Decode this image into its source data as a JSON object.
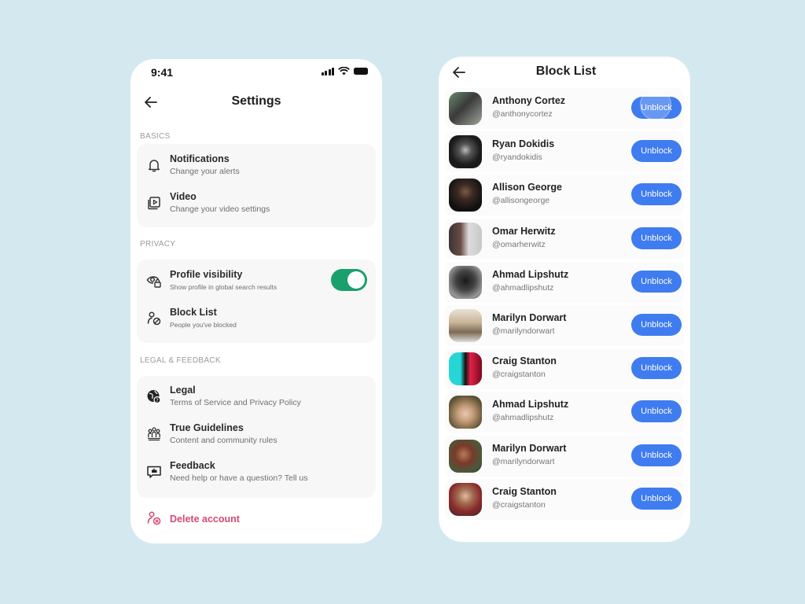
{
  "colors": {
    "background": "#d4e8ef",
    "toggle_on": "#1aa06d",
    "danger": "#d64a72",
    "primary": "#3f7cf0"
  },
  "settings_screen": {
    "status_bar": {
      "time": "9:41",
      "icons": [
        "signal-icon",
        "wifi-icon",
        "battery-icon"
      ]
    },
    "header": {
      "back_icon": "arrow-left-icon",
      "title": "Settings"
    },
    "sections": [
      {
        "label": "BASICS",
        "items": [
          {
            "icon": "bell-icon",
            "title": "Notifications",
            "subtitle": "Change your alerts"
          },
          {
            "icon": "video-library-icon",
            "title": "Video",
            "subtitle": "Change your video settings"
          }
        ]
      },
      {
        "label": "PRIVACY",
        "items": [
          {
            "icon": "eye-lock-icon",
            "title": "Profile visibility",
            "subtitle": "Show profile in global search results",
            "toggle": true
          },
          {
            "icon": "user-blocked-icon",
            "title": "Block List",
            "subtitle": "People you've blocked"
          }
        ]
      },
      {
        "label": "LEGAL & FEEDBACK",
        "items": [
          {
            "icon": "globe-help-icon",
            "title": "Legal",
            "subtitle": "Terms of Service and Privacy Policy"
          },
          {
            "icon": "community-icon",
            "title": "True Guidelines",
            "subtitle": "Content and community rules"
          },
          {
            "icon": "feedback-icon",
            "title": "Feedback",
            "subtitle": "Need help or have a question? Tell us"
          }
        ]
      }
    ],
    "delete_account": {
      "icon": "user-remove-icon",
      "label": "Delete account"
    }
  },
  "block_list_screen": {
    "header": {
      "back_icon": "arrow-left-icon",
      "title": "Block List"
    },
    "button_label": "Unblock",
    "users": [
      {
        "name": "Anthony Cortez",
        "handle": "@anthonycortez"
      },
      {
        "name": "Ryan Dokidis",
        "handle": "@ryandokidis"
      },
      {
        "name": "Allison George",
        "handle": "@allisongeorge"
      },
      {
        "name": "Omar Herwitz",
        "handle": "@omarherwitz"
      },
      {
        "name": "Ahmad Lipshutz",
        "handle": "@ahmadlipshutz"
      },
      {
        "name": "Marilyn Dorwart",
        "handle": "@marilyndorwart"
      },
      {
        "name": "Craig Stanton",
        "handle": "@craigstanton"
      },
      {
        "name": "Ahmad Lipshutz",
        "handle": "@ahmadlipshutz"
      },
      {
        "name": "Marilyn Dorwart",
        "handle": "@marilyndorwart"
      },
      {
        "name": "Craig Stanton",
        "handle": "@craigstanton"
      }
    ]
  }
}
